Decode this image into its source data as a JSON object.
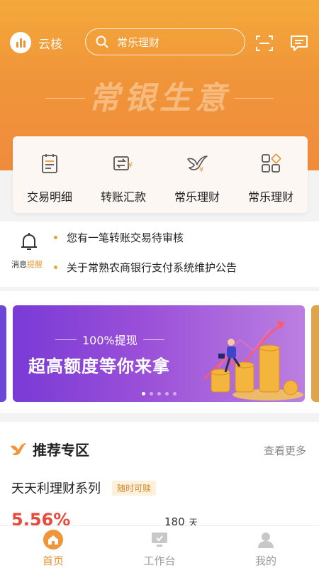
{
  "header": {
    "brand": "云核",
    "search_placeholder": "常乐理财",
    "slogan": "常银生意"
  },
  "quick_actions": [
    {
      "label": "交易明细",
      "icon": "transaction-list-icon"
    },
    {
      "label": "转账汇款",
      "icon": "transfer-icon"
    },
    {
      "label": "常乐理财",
      "icon": "wealth-bird-icon"
    },
    {
      "label": "常乐理财",
      "icon": "apps-grid-icon"
    }
  ],
  "notices": {
    "caption_prefix": "消息",
    "caption_suffix": "提醒",
    "items": [
      "您有一笔转账交易待审核",
      "关于常熟农商银行支付系统维护公告"
    ]
  },
  "banner": {
    "subtitle": "100%提现",
    "title": "超高额度等你来拿",
    "slides": 5,
    "active_slide": 1
  },
  "recommend": {
    "title": "推荐专区",
    "more": "查看更多",
    "product_name": "天天利理财系列",
    "product_tag": "随时可赎",
    "rate": "5.56%",
    "days": "180",
    "days_unit": "天"
  },
  "tabbar": [
    {
      "label": "首页",
      "active": true
    },
    {
      "label": "工作台",
      "active": false
    },
    {
      "label": "我的",
      "active": false
    }
  ],
  "colors": {
    "brand_orange": "#f0953a",
    "accent": "#e8902f",
    "banner_purple": "#7a3ad6",
    "rate_red": "#e84a3a"
  }
}
